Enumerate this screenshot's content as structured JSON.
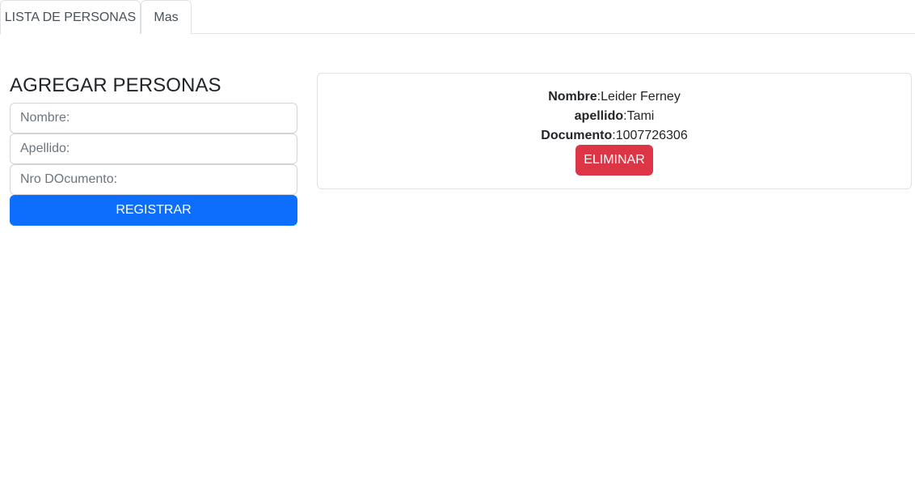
{
  "tabs": [
    {
      "label": "LISTA DE PERSONAS"
    },
    {
      "label": "Mas"
    }
  ],
  "form": {
    "title": "AGREGAR PERSONAS",
    "nombre_placeholder": "Nombre:",
    "apellido_placeholder": "Apellido:",
    "documento_placeholder": "Nro DOcumento:",
    "submit_label": "REGISTRAR"
  },
  "persona": {
    "nombre_label": "Nombre",
    "nombre_value": "Leider Ferney",
    "apellido_label": "apellido",
    "apellido_value": "Tami",
    "documento_label": "Documento",
    "documento_value": "1007726306",
    "delete_label": "ELIMINAR"
  },
  "colors": {
    "primary": "#0d6efd",
    "danger": "#dc3545",
    "border": "#dee2e6"
  }
}
